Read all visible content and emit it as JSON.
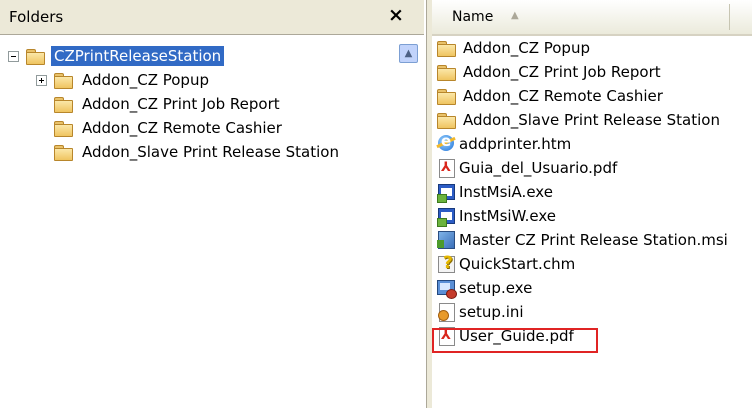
{
  "folders_pane": {
    "title": "Folders",
    "close_glyph": "×",
    "tree": [
      {
        "label": "CZPrintReleaseStation",
        "expander": "minus",
        "level": 0,
        "selected": true
      },
      {
        "label": "Addon_CZ Popup",
        "expander": "plus",
        "level": 1,
        "selected": false
      },
      {
        "label": "Addon_CZ Print Job Report",
        "expander": "",
        "level": 1,
        "selected": false
      },
      {
        "label": "Addon_CZ Remote Cashier",
        "expander": "",
        "level": 1,
        "selected": false
      },
      {
        "label": "Addon_Slave Print Release Station",
        "expander": "",
        "level": 1,
        "selected": false
      }
    ],
    "scroll_glyph": "▲"
  },
  "files_pane": {
    "column_header": {
      "name_label": "Name",
      "sort_glyph": "▲"
    },
    "files": [
      {
        "name": "Addon_CZ Popup",
        "icon": "folder-icon"
      },
      {
        "name": "Addon_CZ Print Job Report",
        "icon": "folder-icon"
      },
      {
        "name": "Addon_CZ Remote Cashier",
        "icon": "folder-icon"
      },
      {
        "name": "Addon_Slave Print Release Station",
        "icon": "folder-icon"
      },
      {
        "name": "addprinter.htm",
        "icon": "ie-icon"
      },
      {
        "name": "Guia_del_Usuario.pdf",
        "icon": "pdf-icon"
      },
      {
        "name": "InstMsiA.exe",
        "icon": "exe-icon"
      },
      {
        "name": "InstMsiW.exe",
        "icon": "exe-icon"
      },
      {
        "name": "Master CZ Print Release Station.msi",
        "icon": "msi-icon"
      },
      {
        "name": "QuickStart.chm",
        "icon": "chm-icon"
      },
      {
        "name": "setup.exe",
        "icon": "setup-icon",
        "highlighted": true
      },
      {
        "name": "setup.ini",
        "icon": "ini-icon"
      },
      {
        "name": "User_Guide.pdf",
        "icon": "pdf-icon"
      }
    ]
  },
  "colors": {
    "selection": "#316ac5",
    "highlight_border": "#e02424",
    "pane_header": "#ece9d8"
  }
}
